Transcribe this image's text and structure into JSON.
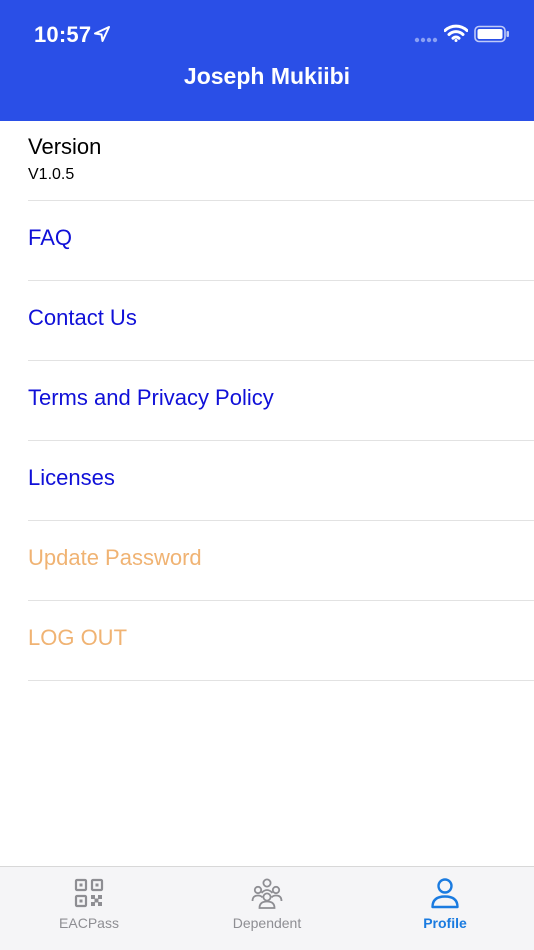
{
  "colors": {
    "header_bg": "#2a4fe7",
    "link_blue": "#1010d8",
    "link_orange": "#f0b373",
    "tab_inactive": "#8e8e93",
    "tab_active": "#1a7be0"
  },
  "status_bar": {
    "time": "10:57"
  },
  "header": {
    "title": "Joseph Mukiibi"
  },
  "version": {
    "label": "Version",
    "value": "V1.0.5"
  },
  "menu": {
    "items": [
      {
        "label": "FAQ",
        "color": "#1010d8"
      },
      {
        "label": "Contact Us",
        "color": "#1010d8"
      },
      {
        "label": "Terms and Privacy Policy",
        "color": "#1010d8"
      },
      {
        "label": "Licenses",
        "color": "#1010d8"
      },
      {
        "label": "Update Password",
        "color": "#f0b373"
      },
      {
        "label": "LOG OUT",
        "color": "#f0b373"
      }
    ]
  },
  "tabbar": {
    "tabs": [
      {
        "label": "EACPass",
        "icon": "qr-code-icon",
        "active": false
      },
      {
        "label": "Dependent",
        "icon": "people-group-icon",
        "active": false
      },
      {
        "label": "Profile",
        "icon": "person-icon",
        "active": true
      }
    ]
  }
}
